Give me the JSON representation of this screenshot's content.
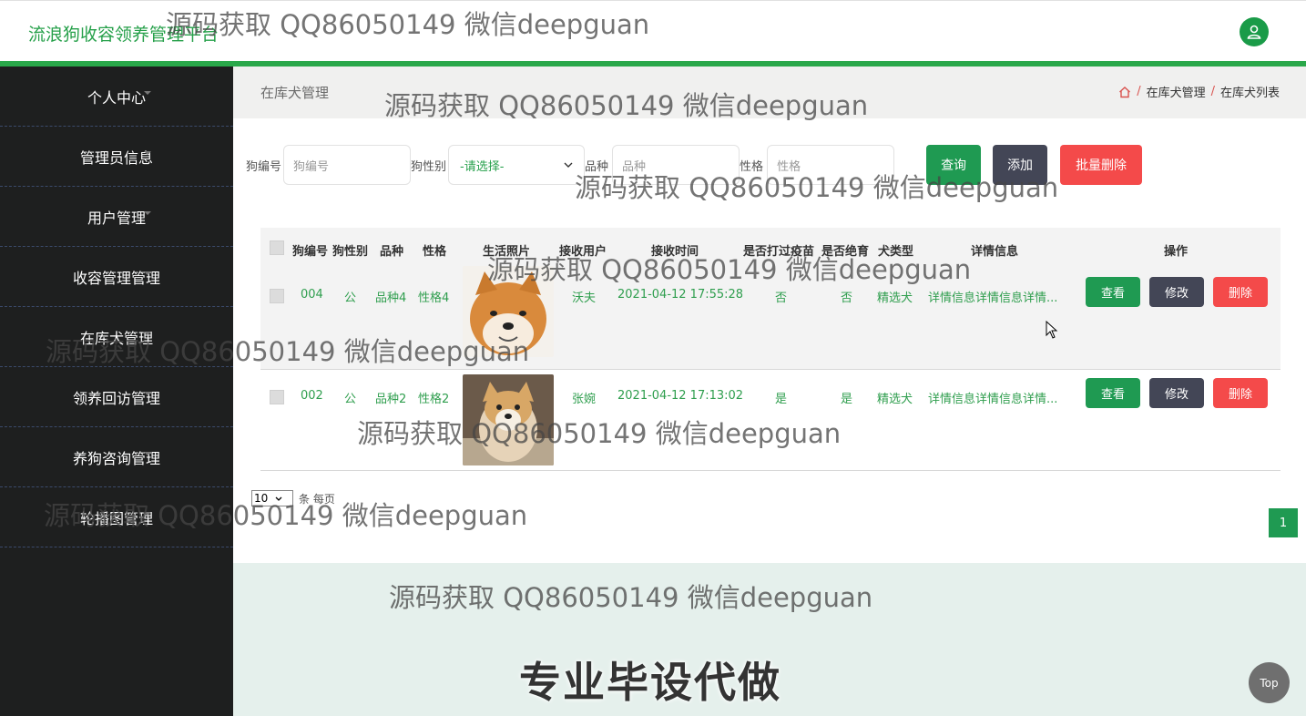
{
  "header": {
    "title": "流浪狗收容领养管理平台"
  },
  "sidebar": {
    "items": [
      {
        "label": "个人中心"
      },
      {
        "label": "管理员信息"
      },
      {
        "label": "用户管理"
      },
      {
        "label": "收容管理管理"
      },
      {
        "label": "在库犬管理"
      },
      {
        "label": "领养回访管理"
      },
      {
        "label": "养狗咨询管理"
      },
      {
        "label": "轮播图管理"
      }
    ]
  },
  "page": {
    "title": "在库犬管理",
    "breadcrumb": [
      "在库犬管理",
      "在库犬列表"
    ]
  },
  "search": {
    "dog_no_label": "狗编号",
    "dog_no_placeholder": "狗编号",
    "sex_label": "狗性别",
    "sex_value": "-请选择-",
    "breed_label": "品种",
    "breed_placeholder": "品种",
    "temper_label": "性格",
    "temper_placeholder": "性格",
    "query_label": "查询",
    "add_label": "添加",
    "batch_delete_label": "批量删除"
  },
  "table": {
    "headers": [
      "狗编号",
      "狗性别",
      "品种",
      "性格",
      "生活照片",
      "接收用户",
      "接收时间",
      "是否打过疫苗",
      "是否绝育",
      "犬类型",
      "详情信息",
      "操作"
    ],
    "rows": [
      {
        "dog_no": "004",
        "sex": "公",
        "breed": "品种4",
        "temper": "性格4",
        "user": "沃夫",
        "time": "2021-04-12 17:55:28",
        "vaccinated": "否",
        "neutered": "否",
        "type": "精选犬",
        "detail": "详情信息详情信息详情..."
      },
      {
        "dog_no": "002",
        "sex": "公",
        "breed": "品种2",
        "temper": "性格2",
        "user": "张婉",
        "time": "2021-04-12 17:13:02",
        "vaccinated": "是",
        "neutered": "是",
        "type": "精选犬",
        "detail": "详情信息详情信息详情..."
      }
    ],
    "actions": {
      "view": "查看",
      "edit": "修改",
      "delete": "删除"
    }
  },
  "pager": {
    "page_size": "10",
    "per_page_text": "条 每页",
    "current_page": "1"
  },
  "footer": {
    "banner": "专业毕设代做"
  },
  "top_button": "Top",
  "watermark": "源码获取 QQ86050149 微信deepguan",
  "colors": {
    "accent": "#2aa84a",
    "sidebar": "#1e1f1f",
    "danger": "#f44a4a",
    "dark_button": "#434656",
    "primary_button": "#1f9a52"
  }
}
